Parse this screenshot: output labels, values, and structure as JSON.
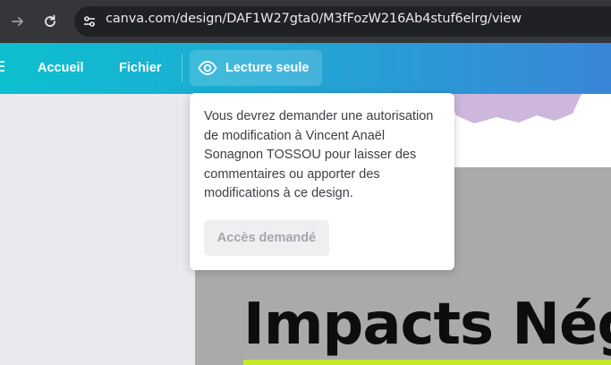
{
  "browser": {
    "url": "canva.com/design/DAF1W27gta0/M3fFozW216Ab4stuf6elrg/view",
    "icons": [
      "arrow-right-icon",
      "reload-icon",
      "site-settings-icon"
    ]
  },
  "toolbar": {
    "home_label": "Accueil",
    "file_label": "Fichier",
    "readonly_label": "Lecture seule",
    "readonly_icon": "eye-icon",
    "gradient": [
      "#0cc0d0",
      "#3a86d8"
    ]
  },
  "popover": {
    "message": "Vous devrez demander une autorisation de modification à Vincent Anaël Sonagnon TOSSOU pour laisser des commentaires ou apporter des modifications à ce design.",
    "button_label": "Accès demandé"
  },
  "canvas": {
    "headline": "Impacts Nég",
    "accent_color": "#c6e82b"
  }
}
